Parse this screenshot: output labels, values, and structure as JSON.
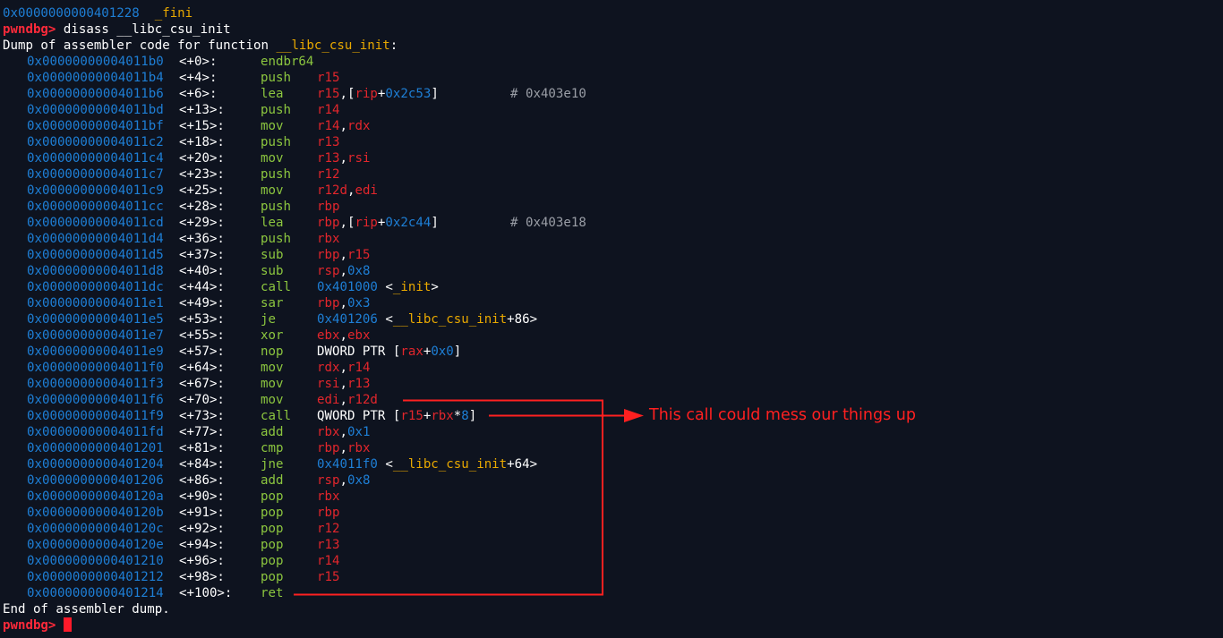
{
  "header": {
    "fini_addr": "0x0000000000401228",
    "fini_name": "_fini"
  },
  "prompt": "pwndbg>",
  "command": "disass __libc_csu_init",
  "dump_header_prefix": "Dump of assembler code for function ",
  "dump_header_func": "__libc_csu_init",
  "dump_header_suffix": ":",
  "instructions": [
    {
      "addr": "0x00000000004011b0",
      "off": "<+0>:",
      "mnem": "endbr64",
      "ops": []
    },
    {
      "addr": "0x00000000004011b4",
      "off": "<+4>:",
      "mnem": "push",
      "ops": [
        {
          "t": "reg",
          "v": "r15"
        }
      ]
    },
    {
      "addr": "0x00000000004011b6",
      "off": "<+6>:",
      "mnem": "lea",
      "ops": [
        {
          "t": "reg",
          "v": "r15"
        },
        {
          "t": "w",
          "v": ",["
        },
        {
          "t": "reg",
          "v": "rip"
        },
        {
          "t": "w",
          "v": "+"
        },
        {
          "t": "num",
          "v": "0x2c53"
        },
        {
          "t": "w",
          "v": "]"
        }
      ],
      "comment": "# 0x403e10"
    },
    {
      "addr": "0x00000000004011bd",
      "off": "<+13>:",
      "mnem": "push",
      "ops": [
        {
          "t": "reg",
          "v": "r14"
        }
      ]
    },
    {
      "addr": "0x00000000004011bf",
      "off": "<+15>:",
      "mnem": "mov",
      "ops": [
        {
          "t": "reg",
          "v": "r14"
        },
        {
          "t": "w",
          "v": ","
        },
        {
          "t": "reg",
          "v": "rdx"
        }
      ]
    },
    {
      "addr": "0x00000000004011c2",
      "off": "<+18>:",
      "mnem": "push",
      "ops": [
        {
          "t": "reg",
          "v": "r13"
        }
      ]
    },
    {
      "addr": "0x00000000004011c4",
      "off": "<+20>:",
      "mnem": "mov",
      "ops": [
        {
          "t": "reg",
          "v": "r13"
        },
        {
          "t": "w",
          "v": ","
        },
        {
          "t": "reg",
          "v": "rsi"
        }
      ]
    },
    {
      "addr": "0x00000000004011c7",
      "off": "<+23>:",
      "mnem": "push",
      "ops": [
        {
          "t": "reg",
          "v": "r12"
        }
      ]
    },
    {
      "addr": "0x00000000004011c9",
      "off": "<+25>:",
      "mnem": "mov",
      "ops": [
        {
          "t": "reg",
          "v": "r12d"
        },
        {
          "t": "w",
          "v": ","
        },
        {
          "t": "reg",
          "v": "edi"
        }
      ]
    },
    {
      "addr": "0x00000000004011cc",
      "off": "<+28>:",
      "mnem": "push",
      "ops": [
        {
          "t": "reg",
          "v": "rbp"
        }
      ]
    },
    {
      "addr": "0x00000000004011cd",
      "off": "<+29>:",
      "mnem": "lea",
      "ops": [
        {
          "t": "reg",
          "v": "rbp"
        },
        {
          "t": "w",
          "v": ",["
        },
        {
          "t": "reg",
          "v": "rip"
        },
        {
          "t": "w",
          "v": "+"
        },
        {
          "t": "num",
          "v": "0x2c44"
        },
        {
          "t": "w",
          "v": "]"
        }
      ],
      "comment": "# 0x403e18"
    },
    {
      "addr": "0x00000000004011d4",
      "off": "<+36>:",
      "mnem": "push",
      "ops": [
        {
          "t": "reg",
          "v": "rbx"
        }
      ]
    },
    {
      "addr": "0x00000000004011d5",
      "off": "<+37>:",
      "mnem": "sub",
      "ops": [
        {
          "t": "reg",
          "v": "rbp"
        },
        {
          "t": "w",
          "v": ","
        },
        {
          "t": "reg",
          "v": "r15"
        }
      ]
    },
    {
      "addr": "0x00000000004011d8",
      "off": "<+40>:",
      "mnem": "sub",
      "ops": [
        {
          "t": "reg",
          "v": "rsp"
        },
        {
          "t": "w",
          "v": ","
        },
        {
          "t": "num",
          "v": "0x8"
        }
      ]
    },
    {
      "addr": "0x00000000004011dc",
      "off": "<+44>:",
      "mnem": "call",
      "ops": [
        {
          "t": "num",
          "v": "0x401000"
        },
        {
          "t": "w",
          "v": " <"
        },
        {
          "t": "sym",
          "v": "_init"
        },
        {
          "t": "w",
          "v": ">"
        }
      ]
    },
    {
      "addr": "0x00000000004011e1",
      "off": "<+49>:",
      "mnem": "sar",
      "ops": [
        {
          "t": "reg",
          "v": "rbp"
        },
        {
          "t": "w",
          "v": ","
        },
        {
          "t": "num",
          "v": "0x3"
        }
      ]
    },
    {
      "addr": "0x00000000004011e5",
      "off": "<+53>:",
      "mnem": "je",
      "ops": [
        {
          "t": "num",
          "v": "0x401206"
        },
        {
          "t": "w",
          "v": " <"
        },
        {
          "t": "sym",
          "v": "__libc_csu_init"
        },
        {
          "t": "w",
          "v": "+86>"
        }
      ]
    },
    {
      "addr": "0x00000000004011e7",
      "off": "<+55>:",
      "mnem": "xor",
      "ops": [
        {
          "t": "reg",
          "v": "ebx"
        },
        {
          "t": "w",
          "v": ","
        },
        {
          "t": "reg",
          "v": "ebx"
        }
      ]
    },
    {
      "addr": "0x00000000004011e9",
      "off": "<+57>:",
      "mnem": "nop",
      "ops": [
        {
          "t": "w",
          "v": "DWORD PTR ["
        },
        {
          "t": "reg",
          "v": "rax"
        },
        {
          "t": "w",
          "v": "+"
        },
        {
          "t": "num",
          "v": "0x0"
        },
        {
          "t": "w",
          "v": "]"
        }
      ]
    },
    {
      "addr": "0x00000000004011f0",
      "off": "<+64>:",
      "mnem": "mov",
      "ops": [
        {
          "t": "reg",
          "v": "rdx"
        },
        {
          "t": "w",
          "v": ","
        },
        {
          "t": "reg",
          "v": "r14"
        }
      ]
    },
    {
      "addr": "0x00000000004011f3",
      "off": "<+67>:",
      "mnem": "mov",
      "ops": [
        {
          "t": "reg",
          "v": "rsi"
        },
        {
          "t": "w",
          "v": ","
        },
        {
          "t": "reg",
          "v": "r13"
        }
      ]
    },
    {
      "addr": "0x00000000004011f6",
      "off": "<+70>:",
      "mnem": "mov",
      "ops": [
        {
          "t": "reg",
          "v": "edi"
        },
        {
          "t": "w",
          "v": ","
        },
        {
          "t": "reg",
          "v": "r12d"
        }
      ]
    },
    {
      "addr": "0x00000000004011f9",
      "off": "<+73>:",
      "mnem": "call",
      "ops": [
        {
          "t": "w",
          "v": "QWORD PTR ["
        },
        {
          "t": "reg",
          "v": "r15"
        },
        {
          "t": "w",
          "v": "+"
        },
        {
          "t": "reg",
          "v": "rbx"
        },
        {
          "t": "w",
          "v": "*"
        },
        {
          "t": "num",
          "v": "8"
        },
        {
          "t": "w",
          "v": "]"
        }
      ]
    },
    {
      "addr": "0x00000000004011fd",
      "off": "<+77>:",
      "mnem": "add",
      "ops": [
        {
          "t": "reg",
          "v": "rbx"
        },
        {
          "t": "w",
          "v": ","
        },
        {
          "t": "num",
          "v": "0x1"
        }
      ]
    },
    {
      "addr": "0x0000000000401201",
      "off": "<+81>:",
      "mnem": "cmp",
      "ops": [
        {
          "t": "reg",
          "v": "rbp"
        },
        {
          "t": "w",
          "v": ","
        },
        {
          "t": "reg",
          "v": "rbx"
        }
      ]
    },
    {
      "addr": "0x0000000000401204",
      "off": "<+84>:",
      "mnem": "jne",
      "ops": [
        {
          "t": "num",
          "v": "0x4011f0"
        },
        {
          "t": "w",
          "v": " <"
        },
        {
          "t": "sym",
          "v": "__libc_csu_init"
        },
        {
          "t": "w",
          "v": "+64>"
        }
      ]
    },
    {
      "addr": "0x0000000000401206",
      "off": "<+86>:",
      "mnem": "add",
      "ops": [
        {
          "t": "reg",
          "v": "rsp"
        },
        {
          "t": "w",
          "v": ","
        },
        {
          "t": "num",
          "v": "0x8"
        }
      ]
    },
    {
      "addr": "0x000000000040120a",
      "off": "<+90>:",
      "mnem": "pop",
      "ops": [
        {
          "t": "reg",
          "v": "rbx"
        }
      ]
    },
    {
      "addr": "0x000000000040120b",
      "off": "<+91>:",
      "mnem": "pop",
      "ops": [
        {
          "t": "reg",
          "v": "rbp"
        }
      ]
    },
    {
      "addr": "0x000000000040120c",
      "off": "<+92>:",
      "mnem": "pop",
      "ops": [
        {
          "t": "reg",
          "v": "r12"
        }
      ]
    },
    {
      "addr": "0x000000000040120e",
      "off": "<+94>:",
      "mnem": "pop",
      "ops": [
        {
          "t": "reg",
          "v": "r13"
        }
      ]
    },
    {
      "addr": "0x0000000000401210",
      "off": "<+96>:",
      "mnem": "pop",
      "ops": [
        {
          "t": "reg",
          "v": "r14"
        }
      ]
    },
    {
      "addr": "0x0000000000401212",
      "off": "<+98>:",
      "mnem": "pop",
      "ops": [
        {
          "t": "reg",
          "v": "r15"
        }
      ]
    },
    {
      "addr": "0x0000000000401214",
      "off": "<+100>:",
      "mnem": "ret",
      "ops": []
    }
  ],
  "dump_footer": "End of assembler dump.",
  "annotation": "This call could mess our things up",
  "colors": {
    "background": "#0e131f",
    "address": "#1e7fd6",
    "prompt": "#ff2a3a",
    "mnemonic": "#8cc63f",
    "register": "#e2262c",
    "symbol": "#e8a800",
    "annotation": "#ff2020"
  }
}
